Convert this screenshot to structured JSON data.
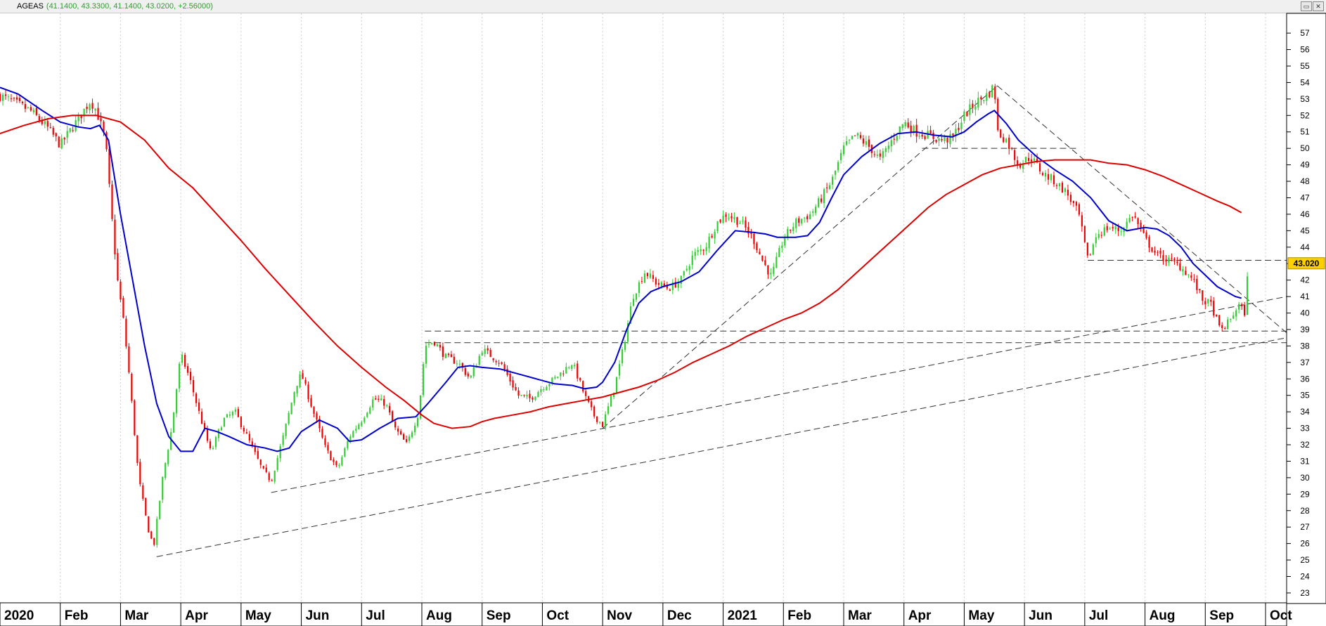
{
  "window": {
    "symbol": "AGEAS",
    "quote": "(41.1400, 43.3300, 41.1400, 43.0200, +2.56000)",
    "restore_glyph": "▭",
    "close_glyph": "✕"
  },
  "chart_data": {
    "type": "candlestick",
    "price_label": "43.020",
    "y_ticks": [
      23,
      24,
      25,
      26,
      27,
      28,
      29,
      30,
      31,
      32,
      33,
      34,
      35,
      36,
      37,
      38,
      39,
      40,
      41,
      42,
      43,
      44,
      45,
      46,
      47,
      48,
      49,
      50,
      51,
      52,
      53,
      54,
      55,
      56,
      57
    ],
    "ylim": [
      22.4,
      58.2
    ],
    "x_labels": [
      {
        "label": "2020",
        "month": 0
      },
      {
        "label": "Feb",
        "month": 1
      },
      {
        "label": "Mar",
        "month": 2
      },
      {
        "label": "Apr",
        "month": 3
      },
      {
        "label": "May",
        "month": 4
      },
      {
        "label": "Jun",
        "month": 5
      },
      {
        "label": "Jul",
        "month": 6
      },
      {
        "label": "Aug",
        "month": 7
      },
      {
        "label": "Sep",
        "month": 8
      },
      {
        "label": "Oct",
        "month": 9
      },
      {
        "label": "Nov",
        "month": 10
      },
      {
        "label": "Dec",
        "month": 11
      },
      {
        "label": "2021",
        "month": 12
      },
      {
        "label": "Feb",
        "month": 13
      },
      {
        "label": "Mar",
        "month": 14
      },
      {
        "label": "Apr",
        "month": 15
      },
      {
        "label": "May",
        "month": 16
      },
      {
        "label": "Jun",
        "month": 17
      },
      {
        "label": "Jul",
        "month": 18
      },
      {
        "label": "Aug",
        "month": 19
      },
      {
        "label": "Sep",
        "month": 20
      },
      {
        "label": "Oct",
        "month": 21
      }
    ],
    "xlim": [
      0.0,
      21.35
    ],
    "price_path": [
      [
        0.0,
        53.2
      ],
      [
        0.5,
        52.3
      ],
      [
        0.8,
        51.2
      ],
      [
        1.0,
        50.2
      ],
      [
        1.3,
        51.8
      ],
      [
        1.5,
        52.9
      ],
      [
        1.6,
        52.3
      ],
      [
        1.75,
        50.5
      ],
      [
        1.85,
        46.0
      ],
      [
        1.95,
        42.0
      ],
      [
        2.05,
        39.5
      ],
      [
        2.15,
        36.0
      ],
      [
        2.3,
        30.0
      ],
      [
        2.45,
        27.0
      ],
      [
        2.55,
        25.8
      ],
      [
        2.7,
        30.0
      ],
      [
        2.85,
        33.0
      ],
      [
        3.0,
        37.5
      ],
      [
        3.15,
        36.0
      ],
      [
        3.3,
        34.0
      ],
      [
        3.5,
        31.5
      ],
      [
        3.7,
        33.5
      ],
      [
        3.9,
        34.0
      ],
      [
        4.1,
        32.5
      ],
      [
        4.35,
        30.5
      ],
      [
        4.5,
        29.8
      ],
      [
        4.7,
        32.5
      ],
      [
        4.9,
        35.5
      ],
      [
        5.0,
        36.3
      ],
      [
        5.2,
        34.0
      ],
      [
        5.4,
        31.8
      ],
      [
        5.6,
        30.5
      ],
      [
        5.8,
        32.5
      ],
      [
        6.0,
        33.5
      ],
      [
        6.2,
        34.8
      ],
      [
        6.4,
        34.5
      ],
      [
        6.55,
        33.0
      ],
      [
        6.75,
        32.0
      ],
      [
        6.95,
        34.0
      ],
      [
        7.05,
        38.0
      ],
      [
        7.2,
        38.3
      ],
      [
        7.4,
        37.3
      ],
      [
        7.6,
        37.0
      ],
      [
        7.8,
        36.0
      ],
      [
        8.0,
        37.8
      ],
      [
        8.3,
        37.0
      ],
      [
        8.6,
        35.0
      ],
      [
        8.8,
        34.8
      ],
      [
        9.0,
        35.5
      ],
      [
        9.2,
        36.0
      ],
      [
        9.5,
        37.0
      ],
      [
        9.7,
        35.0
      ],
      [
        9.85,
        33.8
      ],
      [
        10.0,
        33.2
      ],
      [
        10.2,
        35.5
      ],
      [
        10.35,
        38.0
      ],
      [
        10.5,
        41.0
      ],
      [
        10.7,
        42.5
      ],
      [
        10.9,
        41.8
      ],
      [
        11.1,
        41.5
      ],
      [
        11.3,
        42.0
      ],
      [
        11.5,
        43.5
      ],
      [
        11.7,
        44.0
      ],
      [
        11.9,
        45.5
      ],
      [
        12.05,
        46.0
      ],
      [
        12.3,
        45.5
      ],
      [
        12.5,
        44.5
      ],
      [
        12.65,
        43.2
      ],
      [
        12.8,
        42.2
      ],
      [
        13.0,
        44.5
      ],
      [
        13.2,
        45.5
      ],
      [
        13.45,
        46.0
      ],
      [
        13.6,
        46.8
      ],
      [
        13.8,
        48.0
      ],
      [
        14.0,
        50.0
      ],
      [
        14.2,
        50.8
      ],
      [
        14.45,
        50.0
      ],
      [
        14.6,
        49.3
      ],
      [
        14.8,
        50.5
      ],
      [
        15.0,
        51.6
      ],
      [
        15.2,
        51.0
      ],
      [
        15.4,
        50.8
      ],
      [
        15.6,
        50.5
      ],
      [
        15.8,
        50.6
      ],
      [
        16.0,
        52.0
      ],
      [
        16.2,
        52.8
      ],
      [
        16.4,
        53.3
      ],
      [
        16.5,
        53.8
      ],
      [
        16.55,
        51.0
      ],
      [
        16.7,
        50.5
      ],
      [
        16.9,
        49.0
      ],
      [
        17.1,
        49.5
      ],
      [
        17.3,
        48.5
      ],
      [
        17.5,
        48.0
      ],
      [
        17.7,
        47.3
      ],
      [
        17.9,
        46.0
      ],
      [
        18.05,
        43.2
      ],
      [
        18.2,
        44.8
      ],
      [
        18.4,
        45.2
      ],
      [
        18.6,
        45.0
      ],
      [
        18.8,
        46.0
      ],
      [
        19.0,
        44.5
      ],
      [
        19.2,
        43.5
      ],
      [
        19.4,
        43.2
      ],
      [
        19.6,
        42.8
      ],
      [
        19.8,
        42.0
      ],
      [
        19.95,
        40.8
      ],
      [
        20.1,
        40.5
      ],
      [
        20.25,
        38.9
      ],
      [
        20.4,
        39.5
      ],
      [
        20.55,
        40.5
      ],
      [
        20.65,
        40.0
      ],
      [
        20.72,
        43.02
      ]
    ],
    "series": [
      {
        "color": "#0000cc",
        "points": [
          [
            0.0,
            53.7
          ],
          [
            0.3,
            53.3
          ],
          [
            0.7,
            52.3
          ],
          [
            1.0,
            51.6
          ],
          [
            1.3,
            51.3
          ],
          [
            1.5,
            51.2
          ],
          [
            1.65,
            51.4
          ],
          [
            1.8,
            50.5
          ],
          [
            2.0,
            46.0
          ],
          [
            2.2,
            42.0
          ],
          [
            2.4,
            38.0
          ],
          [
            2.6,
            34.5
          ],
          [
            2.8,
            32.5
          ],
          [
            3.0,
            31.6
          ],
          [
            3.2,
            31.6
          ],
          [
            3.4,
            33.0
          ],
          [
            3.6,
            32.8
          ],
          [
            3.8,
            32.5
          ],
          [
            4.1,
            32.0
          ],
          [
            4.4,
            31.8
          ],
          [
            4.6,
            31.6
          ],
          [
            4.8,
            31.8
          ],
          [
            5.0,
            32.8
          ],
          [
            5.3,
            33.5
          ],
          [
            5.6,
            33.0
          ],
          [
            5.8,
            32.2
          ],
          [
            6.0,
            32.3
          ],
          [
            6.3,
            33.0
          ],
          [
            6.6,
            33.6
          ],
          [
            6.9,
            33.7
          ],
          [
            7.1,
            34.5
          ],
          [
            7.4,
            35.8
          ],
          [
            7.6,
            36.7
          ],
          [
            7.8,
            36.8
          ],
          [
            8.0,
            36.7
          ],
          [
            8.3,
            36.6
          ],
          [
            8.6,
            36.3
          ],
          [
            8.9,
            36.0
          ],
          [
            9.2,
            35.7
          ],
          [
            9.5,
            35.6
          ],
          [
            9.7,
            35.4
          ],
          [
            9.9,
            35.5
          ],
          [
            10.0,
            35.8
          ],
          [
            10.2,
            37.0
          ],
          [
            10.4,
            39.0
          ],
          [
            10.6,
            40.6
          ],
          [
            10.8,
            41.3
          ],
          [
            11.0,
            41.6
          ],
          [
            11.3,
            41.9
          ],
          [
            11.6,
            42.5
          ],
          [
            11.9,
            43.8
          ],
          [
            12.2,
            45.0
          ],
          [
            12.5,
            44.9
          ],
          [
            12.7,
            44.8
          ],
          [
            12.9,
            44.6
          ],
          [
            13.2,
            44.6
          ],
          [
            13.4,
            44.7
          ],
          [
            13.6,
            45.5
          ],
          [
            13.8,
            47.0
          ],
          [
            14.0,
            48.4
          ],
          [
            14.3,
            49.5
          ],
          [
            14.6,
            50.3
          ],
          [
            14.9,
            50.9
          ],
          [
            15.2,
            51.0
          ],
          [
            15.5,
            50.8
          ],
          [
            15.8,
            50.7
          ],
          [
            16.0,
            51.0
          ],
          [
            16.2,
            51.6
          ],
          [
            16.4,
            52.1
          ],
          [
            16.5,
            52.3
          ],
          [
            16.7,
            51.5
          ],
          [
            16.9,
            50.5
          ],
          [
            17.2,
            49.5
          ],
          [
            17.5,
            48.7
          ],
          [
            17.8,
            48.0
          ],
          [
            18.1,
            47.0
          ],
          [
            18.4,
            45.6
          ],
          [
            18.7,
            45.0
          ],
          [
            19.0,
            45.2
          ],
          [
            19.2,
            45.1
          ],
          [
            19.4,
            44.7
          ],
          [
            19.6,
            44.0
          ],
          [
            19.8,
            43.0
          ],
          [
            20.0,
            42.3
          ],
          [
            20.2,
            41.6
          ],
          [
            20.5,
            41.0
          ],
          [
            20.6,
            40.9
          ]
        ]
      },
      {
        "color": "#dd0000",
        "points": [
          [
            0.0,
            50.9
          ],
          [
            0.4,
            51.4
          ],
          [
            0.8,
            51.8
          ],
          [
            1.2,
            52.0
          ],
          [
            1.6,
            52.0
          ],
          [
            2.0,
            51.6
          ],
          [
            2.4,
            50.5
          ],
          [
            2.8,
            48.8
          ],
          [
            3.2,
            47.6
          ],
          [
            3.6,
            46.0
          ],
          [
            4.0,
            44.4
          ],
          [
            4.4,
            42.7
          ],
          [
            4.8,
            41.1
          ],
          [
            5.2,
            39.5
          ],
          [
            5.6,
            38.0
          ],
          [
            6.0,
            36.7
          ],
          [
            6.4,
            35.5
          ],
          [
            6.7,
            34.7
          ],
          [
            7.0,
            33.8
          ],
          [
            7.2,
            33.3
          ],
          [
            7.5,
            33.0
          ],
          [
            7.8,
            33.1
          ],
          [
            8.0,
            33.4
          ],
          [
            8.2,
            33.6
          ],
          [
            8.5,
            33.8
          ],
          [
            8.8,
            34.0
          ],
          [
            9.1,
            34.3
          ],
          [
            9.4,
            34.5
          ],
          [
            9.7,
            34.7
          ],
          [
            10.0,
            34.9
          ],
          [
            10.3,
            35.2
          ],
          [
            10.6,
            35.5
          ],
          [
            10.9,
            35.9
          ],
          [
            11.2,
            36.4
          ],
          [
            11.5,
            37.0
          ],
          [
            11.8,
            37.5
          ],
          [
            12.1,
            38.0
          ],
          [
            12.4,
            38.6
          ],
          [
            12.7,
            39.1
          ],
          [
            13.0,
            39.6
          ],
          [
            13.3,
            40.0
          ],
          [
            13.6,
            40.6
          ],
          [
            13.9,
            41.4
          ],
          [
            14.2,
            42.4
          ],
          [
            14.5,
            43.4
          ],
          [
            14.8,
            44.4
          ],
          [
            15.1,
            45.4
          ],
          [
            15.4,
            46.4
          ],
          [
            15.7,
            47.2
          ],
          [
            16.0,
            47.8
          ],
          [
            16.3,
            48.4
          ],
          [
            16.6,
            48.8
          ],
          [
            16.9,
            49.0
          ],
          [
            17.2,
            49.2
          ],
          [
            17.5,
            49.3
          ],
          [
            17.8,
            49.3
          ],
          [
            18.1,
            49.3
          ],
          [
            18.4,
            49.1
          ],
          [
            18.7,
            49.0
          ],
          [
            19.0,
            48.7
          ],
          [
            19.3,
            48.3
          ],
          [
            19.6,
            47.8
          ],
          [
            19.9,
            47.3
          ],
          [
            20.2,
            46.8
          ],
          [
            20.4,
            46.5
          ],
          [
            20.6,
            46.1
          ]
        ]
      }
    ],
    "trendlines": [
      [
        [
          2.6,
          25.2
        ],
        [
          21.35,
          38.5
        ]
      ],
      [
        [
          4.5,
          29.1
        ],
        [
          21.35,
          41.0
        ]
      ],
      [
        [
          10.0,
          33.0
        ],
        [
          16.55,
          53.8
        ]
      ],
      [
        [
          16.55,
          53.8
        ],
        [
          21.35,
          38.8
        ]
      ],
      [
        [
          7.05,
          38.9
        ],
        [
          21.35,
          38.9
        ]
      ],
      [
        [
          7.05,
          38.2
        ],
        [
          21.35,
          38.2
        ]
      ],
      [
        [
          15.3,
          50.0
        ],
        [
          17.9,
          50.0
        ]
      ],
      [
        [
          18.05,
          43.2
        ],
        [
          21.35,
          43.2
        ]
      ]
    ]
  }
}
